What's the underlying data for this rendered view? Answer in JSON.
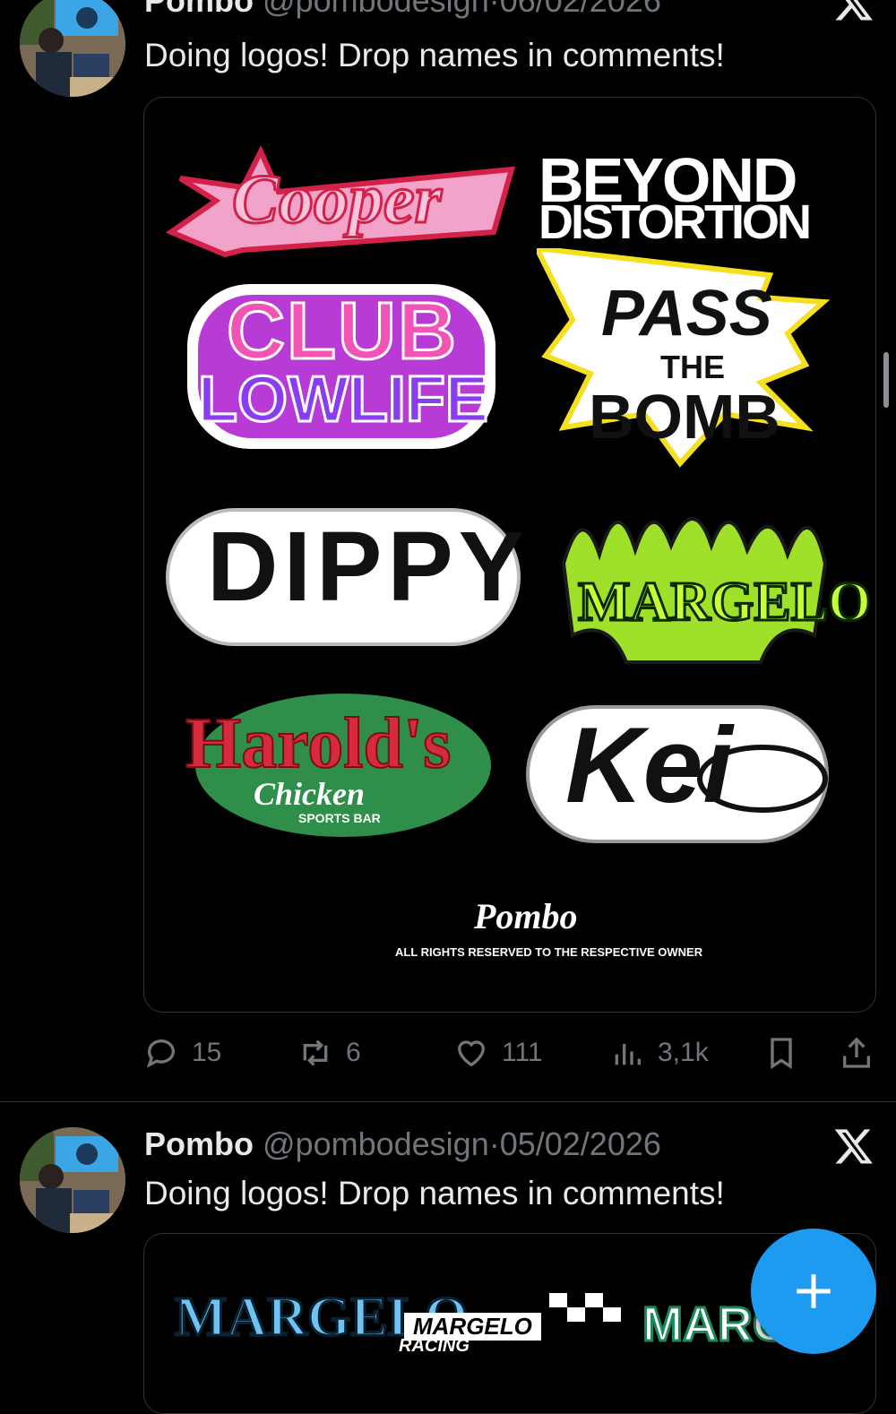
{
  "colors": {
    "accent": "#1d9bf0",
    "muted": "#71767b",
    "text": "#e7e9ea",
    "border": "#2f3336"
  },
  "tweets": [
    {
      "name": "Pombo",
      "handle": "@pombodesign",
      "separator": "·",
      "date": "06/02/2026",
      "text": "Doing logos! Drop names in comments!",
      "image": {
        "logos": [
          "Cooper",
          "BEYOND",
          "DISTORTION",
          "CLUB",
          "LOWLIFE",
          "PASS",
          "THE",
          "BOMB",
          "DIPPY",
          "MARGELO",
          "Harold's",
          "Chicken",
          "SPORTS BAR",
          "Kei"
        ],
        "signature": "Pombo",
        "footer": "ALL RIGHTS RESERVED TO THE RESPECTIVE OWNER"
      },
      "actions": {
        "replies": "15",
        "reposts": "6",
        "likes": "111",
        "views": "3,1k"
      }
    },
    {
      "name": "Pombo",
      "handle": "@pombodesign",
      "separator": "·",
      "date": "05/02/2026",
      "text": "Doing logos! Drop names in comments!",
      "image": {
        "logos": [
          "MARGELO",
          "MARGELO",
          "RACING",
          "MARG"
        ]
      }
    }
  ],
  "icons": [
    "x-logo-icon",
    "reply-icon",
    "repost-icon",
    "like-icon",
    "views-icon",
    "bookmark-icon",
    "share-icon",
    "plus-icon"
  ]
}
